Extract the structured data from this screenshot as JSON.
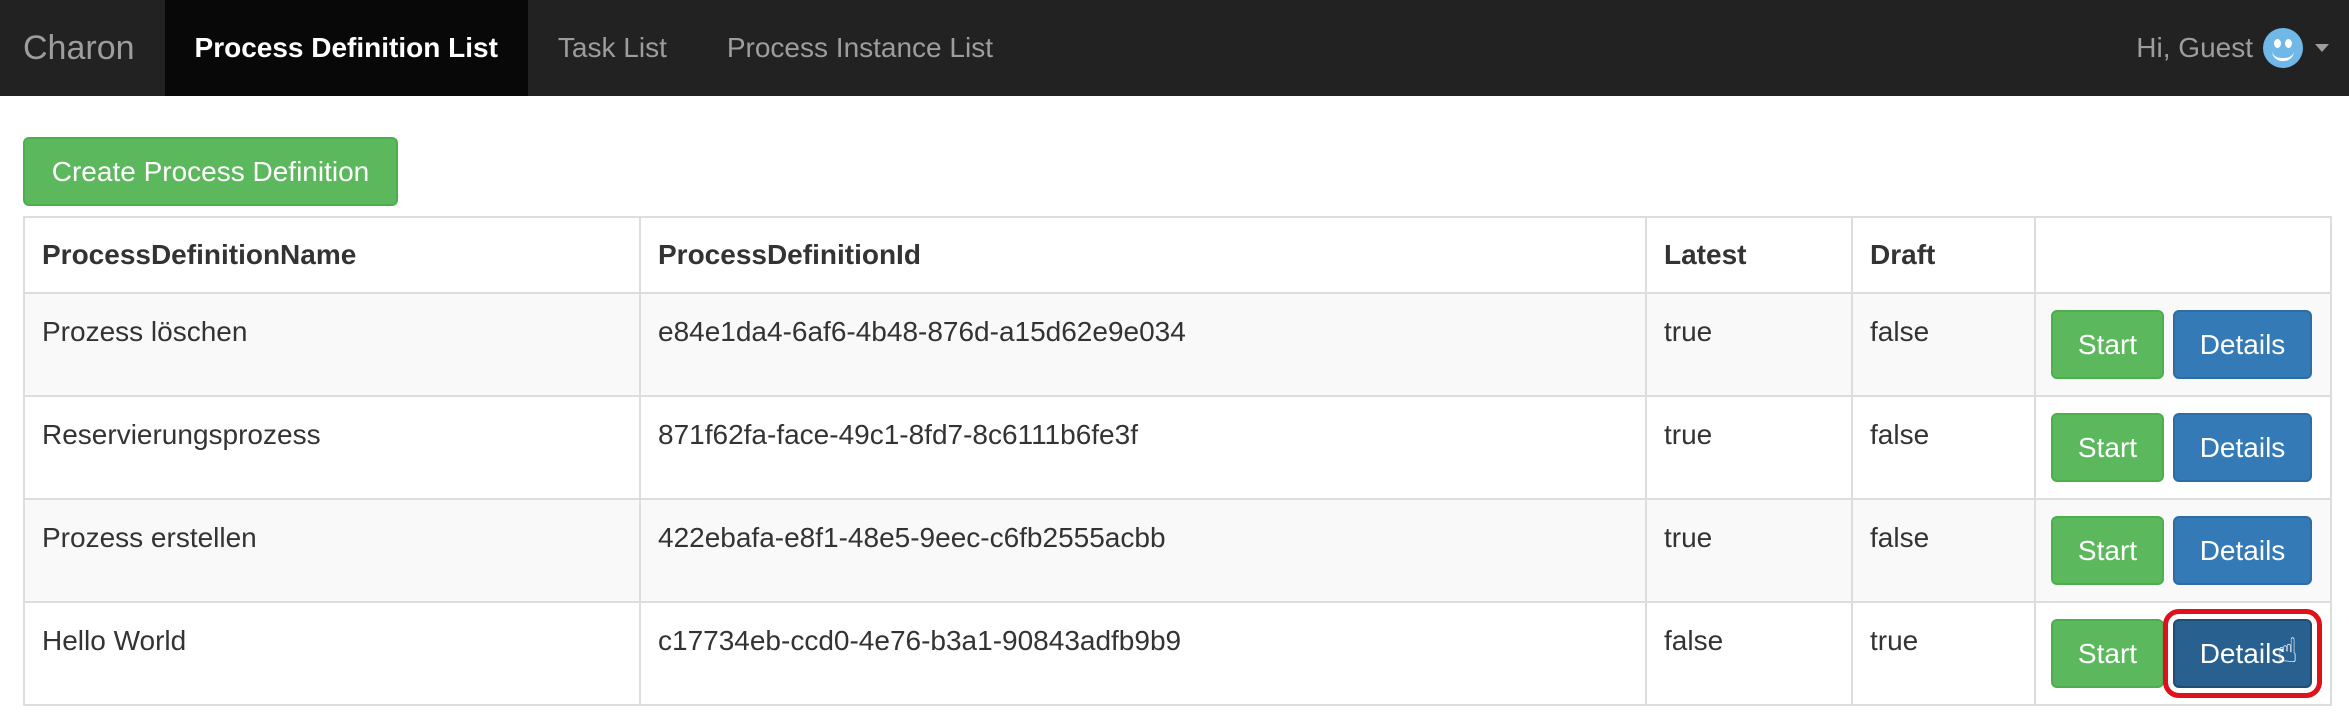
{
  "navbar": {
    "brand": "Charon",
    "items": [
      {
        "label": "Process Definition List",
        "active": true
      },
      {
        "label": "Task List",
        "active": false
      },
      {
        "label": "Process Instance List",
        "active": false
      }
    ],
    "user_greeting": "Hi, Guest",
    "avatar_icon": "smiley-avatar-icon"
  },
  "toolbar": {
    "create_label": "Create Process Definition"
  },
  "table": {
    "headers": [
      "ProcessDefinitionName",
      "ProcessDefinitionId",
      "Latest",
      "Draft",
      ""
    ],
    "rows": [
      {
        "name": "Prozess löschen",
        "id": "e84e1da4-6af6-4b48-876d-a15d62e9e034",
        "latest": "true",
        "draft": "false"
      },
      {
        "name": "Reservierungsprozess",
        "id": "871f62fa-face-49c1-8fd7-8c6111b6fe3f",
        "latest": "true",
        "draft": "false"
      },
      {
        "name": "Prozess erstellen",
        "id": "422ebafa-e8f1-48e5-9eec-c6fb2555acbb",
        "latest": "true",
        "draft": "false"
      },
      {
        "name": "Hello World",
        "id": "c17734eb-ccd0-4e76-b3a1-90843adfb9b9",
        "latest": "false",
        "draft": "true"
      }
    ],
    "start_label": "Start",
    "details_label": "Details"
  },
  "colors": {
    "navbar_bg": "#222222",
    "success": "#5cb85c",
    "primary": "#337ab7",
    "highlight": "#e0111b"
  }
}
